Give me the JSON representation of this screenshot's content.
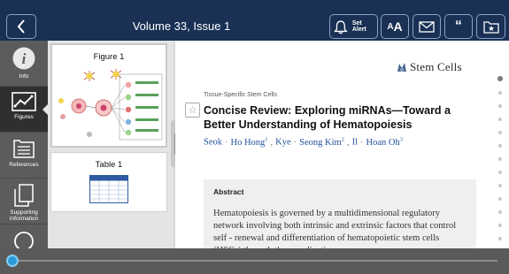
{
  "header": {
    "title": "Volume 33, Issue 1",
    "set_alert_label": "Set Alert",
    "font_small": "A",
    "font_big": "A",
    "cite_label": "“"
  },
  "rail": {
    "items": [
      {
        "label": "Info",
        "icon": "info-icon"
      },
      {
        "label": "Figures",
        "icon": "figures-icon",
        "active": true
      },
      {
        "label": "References",
        "icon": "references-icon"
      },
      {
        "label": "Supporting Information",
        "icon": "supporting-info-icon"
      },
      {
        "label": "",
        "icon": "search-icon"
      }
    ]
  },
  "thumbnails": {
    "figure_title": "Figure 1",
    "table_title": "Table 1"
  },
  "article": {
    "journal": "Stem Cells",
    "section": "Tissue-Specific Stem Cells",
    "title": "Concise Review: Exploring miRNAs—Toward a Better Understanding of Hematopoiesis",
    "authors": [
      {
        "name": "Seok",
        "sup": ""
      },
      {
        "name": "Ho Hong",
        "sup": "1"
      },
      {
        "name": "Kye",
        "sup": ""
      },
      {
        "name": "Seong Kim",
        "sup": "2"
      },
      {
        "name": "Il",
        "sup": ""
      },
      {
        "name": "Hoan Oh",
        "sup": "3"
      }
    ],
    "abstract_heading": "Abstract",
    "abstract_text": "Hematopoiesis is governed by a multidimensional regulatory network involving both intrinsic and extrinsic factors that control self - renewal and differentiation of hematopoietic stem cells (HSCs) through the coordination"
  },
  "colors": {
    "header_bg": "#1a3155",
    "author_link": "#1f4f9c",
    "scrubber": "#2b9bd8"
  },
  "pagination": {
    "total_dots": 15,
    "active_index": 0
  },
  "progress": {
    "fraction": 0.0
  }
}
